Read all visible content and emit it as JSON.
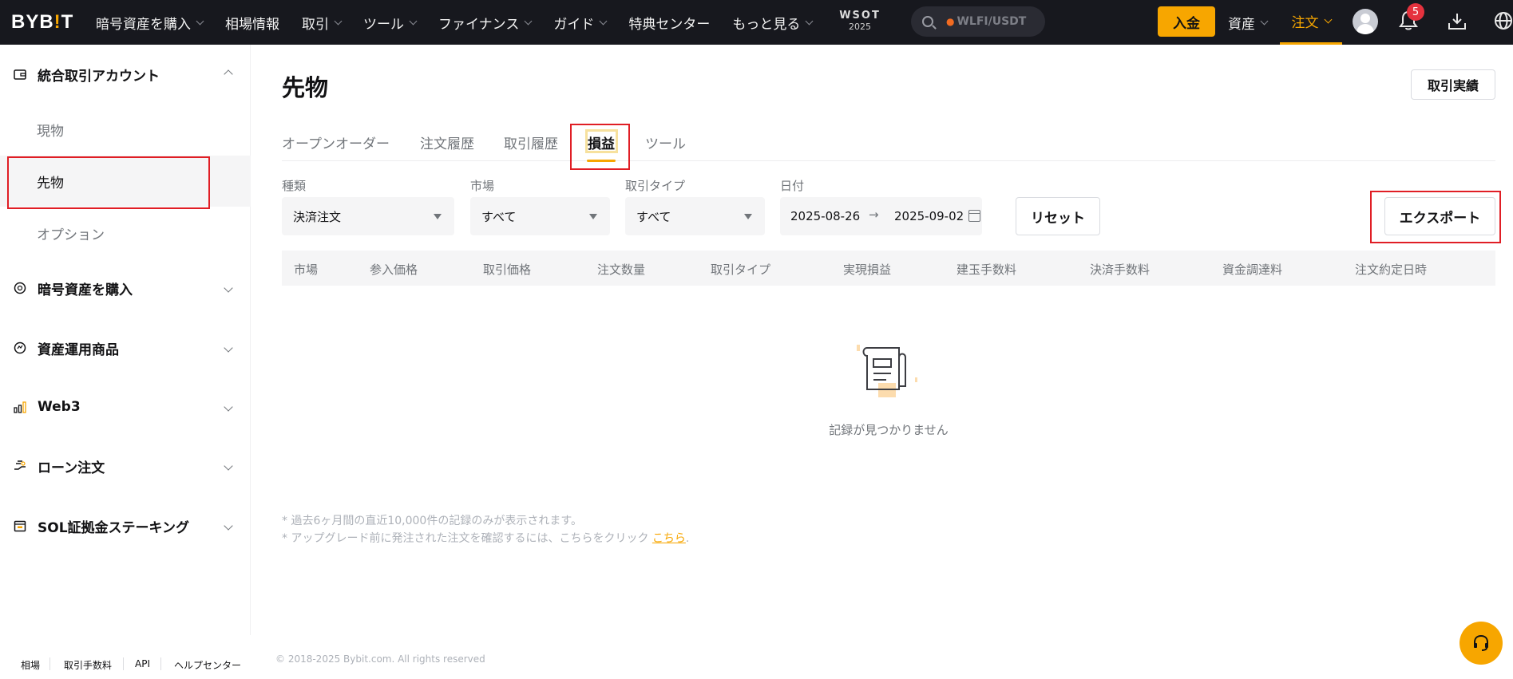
{
  "header": {
    "logo": "BYB!T",
    "nav": [
      {
        "label": "暗号資産を購入",
        "has_dropdown": true
      },
      {
        "label": "相場情報",
        "has_dropdown": false
      },
      {
        "label": "取引",
        "has_dropdown": true
      },
      {
        "label": "ツール",
        "has_dropdown": true
      },
      {
        "label": "ファイナンス",
        "has_dropdown": true
      },
      {
        "label": "ガイド",
        "has_dropdown": true
      },
      {
        "label": "特典センター",
        "has_dropdown": false
      },
      {
        "label": "もっと見る",
        "has_dropdown": true
      }
    ],
    "wsot_line1": "WSOT",
    "wsot_line2": "2025",
    "search_placeholder": "WLFI/USDT",
    "deposit": "入金",
    "assets": "資産",
    "orders": "注文",
    "notification_count": "5",
    "accent_color": "#f7a600"
  },
  "sidebar": {
    "account": "統合取引アカウント",
    "sub_items": [
      "現物",
      "先物",
      "オプション"
    ],
    "active_sub": "先物",
    "groups": [
      "暗号資産を購入",
      "資産運用商品",
      "Web3",
      "ローン注文",
      "SOL証拠金ステーキング"
    ]
  },
  "main": {
    "title": "先物",
    "trade_records": "取引実績",
    "tabs": [
      "オープンオーダー",
      "注文履歴",
      "取引履歴",
      "損益",
      "ツール"
    ],
    "active_tab": "損益",
    "filters": {
      "type_label": "種類",
      "type_value": "決済注文",
      "market_label": "市場",
      "market_value": "すべて",
      "trade_type_label": "取引タイプ",
      "trade_type_value": "すべて",
      "date_label": "日付",
      "date_from": "2025-08-26",
      "date_arrow": "→",
      "date_to": "2025-09-02"
    },
    "reset": "リセット",
    "export": "エクスポート",
    "table_headers": [
      "市場",
      "参入価格",
      "取引価格",
      "注文数量",
      "取引タイプ",
      "実現損益",
      "建玉手数料",
      "決済手数料",
      "資金調達料",
      "注文約定日時"
    ],
    "empty_text": "記録が見つかりません",
    "note1": "* 過去6ヶ月間の直近10,000件の記録のみが表示されます。",
    "note2": "* アップグレード前に発注された注文を確認するには、こちらをクリック ",
    "note2_link": "こちら",
    "note2_end": "."
  },
  "footer": {
    "links": [
      "相場",
      "取引手数料",
      "API",
      "ヘルプセンター"
    ],
    "copyright": "© 2018-2025 Bybit.com. All rights reserved"
  }
}
